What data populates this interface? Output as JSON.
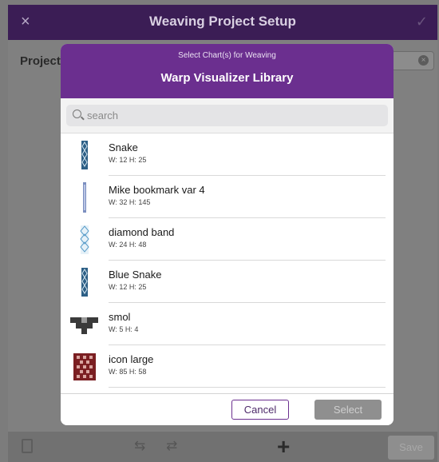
{
  "app": {
    "title": "Weaving Project Setup",
    "close_glyph": "×",
    "confirm_glyph": "✓",
    "project_label": "Project",
    "save_label": "Save",
    "add_glyph": "+"
  },
  "modal": {
    "subtitle": "Select Chart(s) for Weaving",
    "title": "Warp Visualizer Library",
    "search_placeholder": "search",
    "cancel_label": "Cancel",
    "select_label": "Select",
    "items": [
      {
        "name": "Snake",
        "dims": "W: 12 H: 25",
        "icon": "snake-thumbnail"
      },
      {
        "name": "Mike bookmark var 4",
        "dims": "W: 32 H: 145",
        "icon": "bookmark-thumbnail"
      },
      {
        "name": "diamond band",
        "dims": "W: 24 H: 48",
        "icon": "diamond-thumbnail"
      },
      {
        "name": "Blue Snake",
        "dims": "W: 12 H: 25",
        "icon": "snake-thumbnail"
      },
      {
        "name": "smol",
        "dims": "W: 5 H: 4",
        "icon": "smol-thumbnail"
      },
      {
        "name": "icon large",
        "dims": "W: 85 H: 58",
        "icon": "icon-large-thumbnail"
      }
    ]
  },
  "colors": {
    "header_bg": "#3b1d55",
    "modal_header_bg": "#6b2f8f",
    "snake_blue": "#2d5f86",
    "icon_large_red": "#7b1f22"
  }
}
